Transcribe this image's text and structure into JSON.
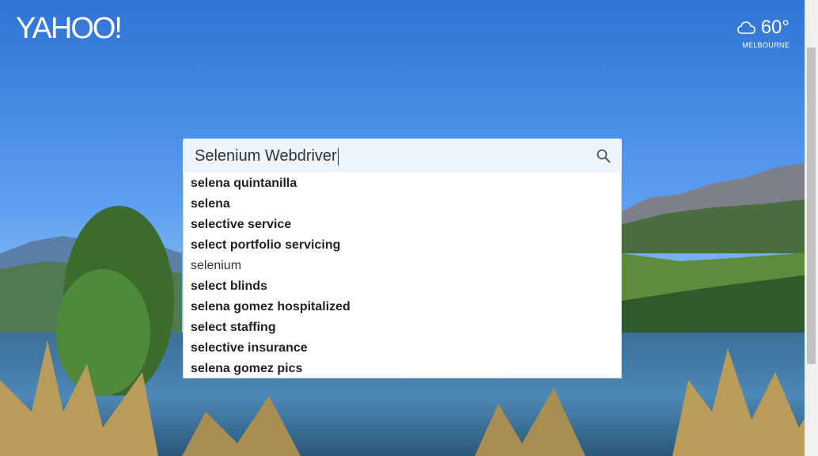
{
  "brand": {
    "logo_text": "YAHOO!"
  },
  "weather": {
    "icon": "cloud-icon",
    "temperature": "60°",
    "location": "MELBOURNE"
  },
  "search": {
    "query": "Selenium Webdriver",
    "icon": "search-icon"
  },
  "suggestions": [
    {
      "text": "selena quintanilla",
      "bold": true
    },
    {
      "text": "selena",
      "bold": true
    },
    {
      "text": "selective service",
      "bold": true
    },
    {
      "text": "select portfolio servicing",
      "bold": true
    },
    {
      "text": "selenium",
      "bold": false
    },
    {
      "text": "select blinds",
      "bold": true
    },
    {
      "text": "selena gomez hospitalized",
      "bold": true
    },
    {
      "text": "select staffing",
      "bold": true
    },
    {
      "text": "selective insurance",
      "bold": true
    },
    {
      "text": "selena gomez pics",
      "bold": true
    }
  ],
  "colors": {
    "sky_top": "#3f86e0",
    "sky_bottom": "#a9cdf2",
    "search_bg": "#eef5fc"
  }
}
